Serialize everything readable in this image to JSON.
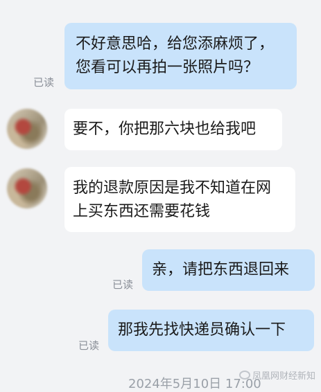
{
  "read_label": "已读",
  "messages": [
    {
      "side": "out",
      "text_line1": "不好意思哈，给您添麻烦了，",
      "text_line2": "您看可以再拍一张照片吗？",
      "read": true
    },
    {
      "side": "in",
      "text": "要不，你把那六块也给我吧"
    },
    {
      "side": "in",
      "text_line1": "我的退款原因是我不知道在网",
      "text_line2": "上买东西还需要花钱"
    },
    {
      "side": "out",
      "text": "亲，请把东西退回来",
      "read": true
    },
    {
      "side": "out",
      "text": "那我先找快递员确认一下",
      "read": true
    }
  ],
  "footer_time": "2024年5月10日 17:00",
  "watermark": "凤凰网财经新知"
}
